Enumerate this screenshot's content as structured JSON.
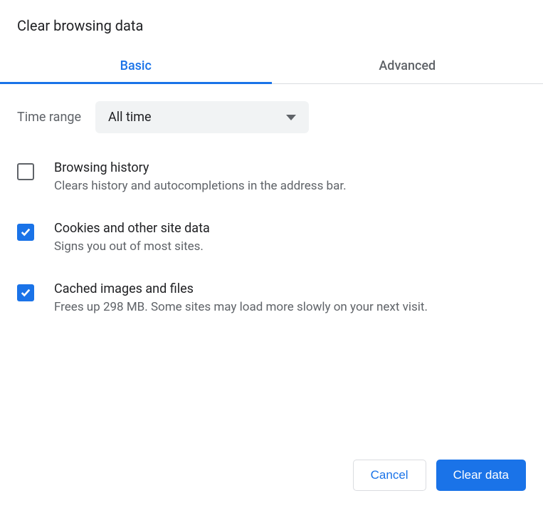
{
  "title": "Clear browsing data",
  "tabs": {
    "basic": "Basic",
    "advanced": "Advanced"
  },
  "timerange": {
    "label": "Time range",
    "value": "All time"
  },
  "options": {
    "browsing_history": {
      "title": "Browsing history",
      "desc": "Clears history and autocompletions in the address bar.",
      "checked": false
    },
    "cookies": {
      "title": "Cookies and other site data",
      "desc": "Signs you out of most sites.",
      "checked": true
    },
    "cache": {
      "title": "Cached images and files",
      "desc": "Frees up 298 MB. Some sites may load more slowly on your next visit.",
      "checked": true
    }
  },
  "buttons": {
    "cancel": "Cancel",
    "clear": "Clear data"
  }
}
